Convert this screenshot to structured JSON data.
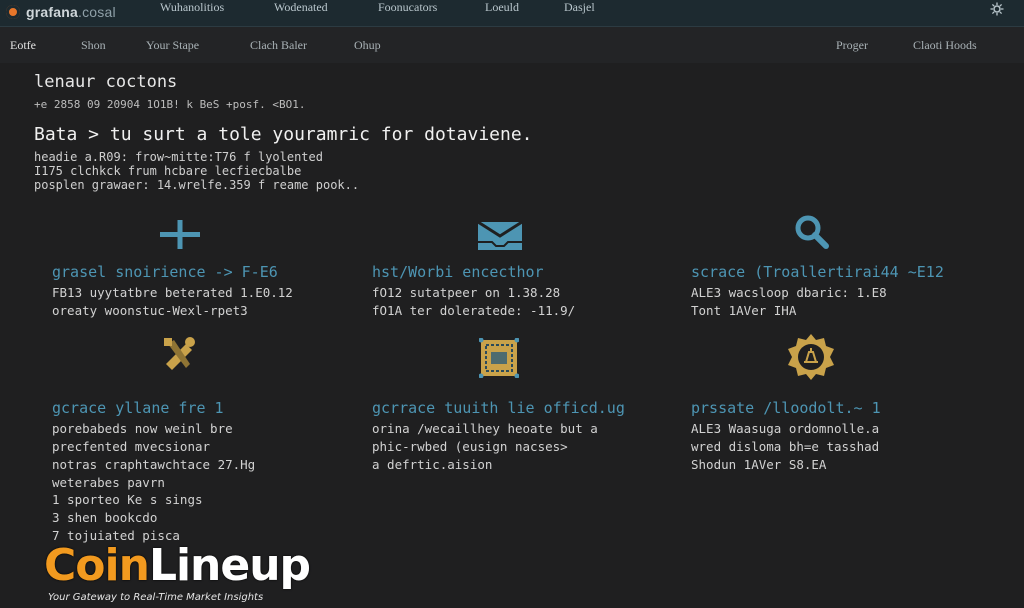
{
  "topbar": {
    "brand_main": "grafana",
    "brand_suffix": ".cosal",
    "nav": [
      "Wuhanolitios",
      "Wodenated",
      "Foonucators",
      "Loeuld",
      "Dasjel"
    ],
    "right_icon": "settings-icon"
  },
  "subbar": {
    "left": [
      "Eotfe",
      "Shon",
      "Your Stape",
      "Clach Baler",
      "Ohup"
    ],
    "right": [
      "Proger",
      "Claoti Hoods"
    ]
  },
  "header": {
    "crumb": "lenaur coctons",
    "meta": "+e 2858 09 20904 1O1B! k BeS +posf. <BO1.",
    "title": "Bata > tu surt a tole youramric for dotaviene.",
    "desc": [
      "headie a.R09: frow~mitte:T76 f lyolented",
      "I175 clchkck frum hcbare lecfiecbalbe",
      "posplen grawaer: 14.wrelfe.359 f reame pook.."
    ]
  },
  "cards": [
    {
      "icon": "plus-icon",
      "title": "grasel snoirience -> F-E6",
      "lines": [
        "FB13 uyytatbre beterated 1.E0.12",
        "oreaty woonstuc-Wexl-rpet3"
      ]
    },
    {
      "icon": "inbox-icon",
      "title": "hst/Worbi encecthor",
      "lines": [
        "fO12 sutatpeer on 1.38.28",
        "fO1A ter doleratede: -11.9/"
      ]
    },
    {
      "icon": "search-icon",
      "title": "scrace (Troallertirai44 ~E12",
      "lines": [
        "ALE3 wacsloop dbaric: 1.E8",
        "Tont 1AVer IHA"
      ]
    },
    {
      "icon": "tools-icon",
      "title": "gcrace yllane fre 1",
      "lines": [
        "porebabeds now weinl bre",
        "precfented mvecsionar",
        "notras craphtawchtace 27.Hg",
        "weterabes pavrn",
        "1 sporteo Ke s sings",
        "3 shen bookcdo",
        "7 tojuiated pisca"
      ]
    },
    {
      "icon": "frame-icon",
      "title": "gcrrace tuuith lie officd.ug",
      "lines": [
        "orina /wecaillhey heoate but a",
        "phic-rwbed (eusign nacses>",
        "a defrtic.aision"
      ]
    },
    {
      "icon": "badge-icon",
      "title": "prssate /lloodolt.~ 1",
      "lines": [
        "ALE3 Waasuga ordomnolle.a",
        "wred disloma bh=e tasshad",
        "Shodun 1AVer S8.EA"
      ]
    }
  ],
  "watermark": {
    "coin": "Coin",
    "lineup": "Lineup",
    "tagline": "Your Gateway to Real-Time Market Insights"
  },
  "colors": {
    "accent_blue": "#4d95b3",
    "brand_orange": "#e8762a",
    "icon_gold": "#c9a24a"
  }
}
